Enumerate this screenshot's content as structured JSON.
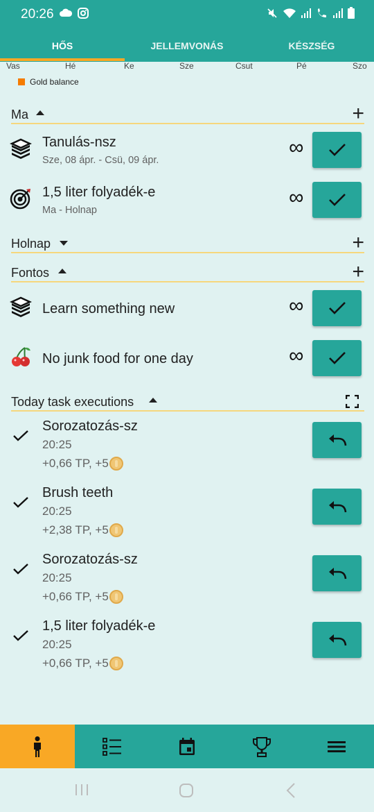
{
  "status_bar": {
    "time": "20:26",
    "left_icons": [
      "cloud-icon",
      "instagram-icon"
    ],
    "right_icons": [
      "mute-icon",
      "wifi-icon",
      "signal-icon",
      "wifi-call-icon",
      "signal-icon",
      "battery-icon"
    ]
  },
  "tabs": [
    {
      "label": "HŐS",
      "active": true
    },
    {
      "label": "JELLEMVONÁS",
      "active": false
    },
    {
      "label": "KÉSZSÉG",
      "active": false
    }
  ],
  "chart_days": [
    "Vas",
    "Hé",
    "Ke",
    "Sze",
    "Csut",
    "Pé",
    "Szo"
  ],
  "legend": {
    "label": "Gold balance",
    "color": "#f57c00"
  },
  "sections": {
    "today": {
      "label": "Ma",
      "expanded": true
    },
    "tomorrow": {
      "label": "Holnap",
      "expanded": false
    },
    "important": {
      "label": "Fontos",
      "expanded": true
    },
    "executions": {
      "label": "Today task executions",
      "expanded": true
    }
  },
  "today_tasks": [
    {
      "title": "Tanulás-nsz",
      "subtitle": "Sze, 08 ápr. - Csü, 09 ápr.",
      "icon": "books-icon",
      "repeat": "∞"
    },
    {
      "title": "1,5 liter folyadék-e",
      "subtitle": "Ma - Holnap",
      "icon": "target-icon",
      "repeat": "∞"
    }
  ],
  "important_tasks": [
    {
      "title": "Learn something new",
      "icon": "books-icon",
      "repeat": "∞"
    },
    {
      "title": "No junk food for one day",
      "icon": "cherry-icon",
      "repeat": "∞"
    }
  ],
  "executions": [
    {
      "title": "Sorozatozás-sz",
      "time": "20:25",
      "reward": "+0,66 TP, +5"
    },
    {
      "title": "Brush teeth",
      "time": "20:25",
      "reward": "+2,38 TP, +5"
    },
    {
      "title": "Sorozatozás-sz",
      "time": "20:25",
      "reward": "+0,66 TP, +5"
    },
    {
      "title": "1,5 liter folyadék-e",
      "time": "20:25",
      "reward": "+0,66 TP, +5"
    }
  ],
  "bottom_nav": [
    "person-icon",
    "checklist-icon",
    "calendar-icon",
    "trophy-icon",
    "menu-icon"
  ],
  "colors": {
    "primary": "#26a69a",
    "accent": "#f9a825",
    "background": "#e0f2f1"
  }
}
